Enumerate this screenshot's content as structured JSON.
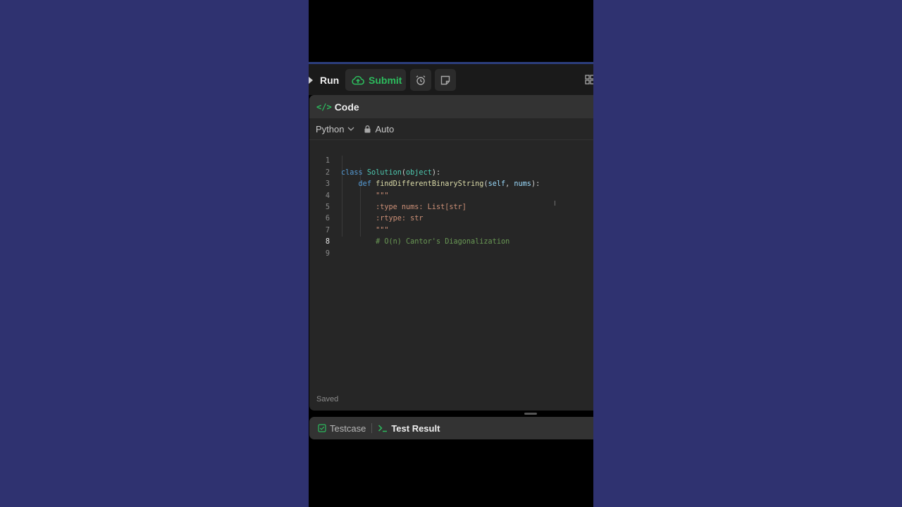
{
  "toolbar": {
    "run_label": "Run",
    "submit_label": "Submit"
  },
  "panel": {
    "title": "Code",
    "language": "Python",
    "mode": "Auto",
    "status": "Saved"
  },
  "editor": {
    "lines": [
      {
        "num": "1"
      },
      {
        "num": "2"
      },
      {
        "num": "3"
      },
      {
        "num": "4"
      },
      {
        "num": "5"
      },
      {
        "num": "6"
      },
      {
        "num": "7"
      },
      {
        "num": "8"
      },
      {
        "num": "9"
      }
    ],
    "tokens": {
      "l1_kw": "class",
      "l1_cls": "Solution",
      "l1_rest_a": "(",
      "l1_arg": "object",
      "l1_rest_b": "):",
      "l2_kw": "def",
      "l2_fn": "findDifferentBinaryString",
      "l2_open": "(",
      "l2_self": "self",
      "l2_comma": ", ",
      "l2_nums": "nums",
      "l2_close": "):",
      "l3_str": "\"\"\"",
      "l4_str": ":type nums: List[str]",
      "l5_str": ":rtype: str",
      "l6_str": "\"\"\"",
      "l7_cm": "# O(n) Cantor's Diagonalization"
    },
    "active_line": "8"
  },
  "bottom": {
    "testcase_label": "Testcase",
    "result_label": "Test Result"
  },
  "colors": {
    "accent_green": "#2cbb5d",
    "background_outer": "#2f3270",
    "panel_bg": "#262626"
  }
}
